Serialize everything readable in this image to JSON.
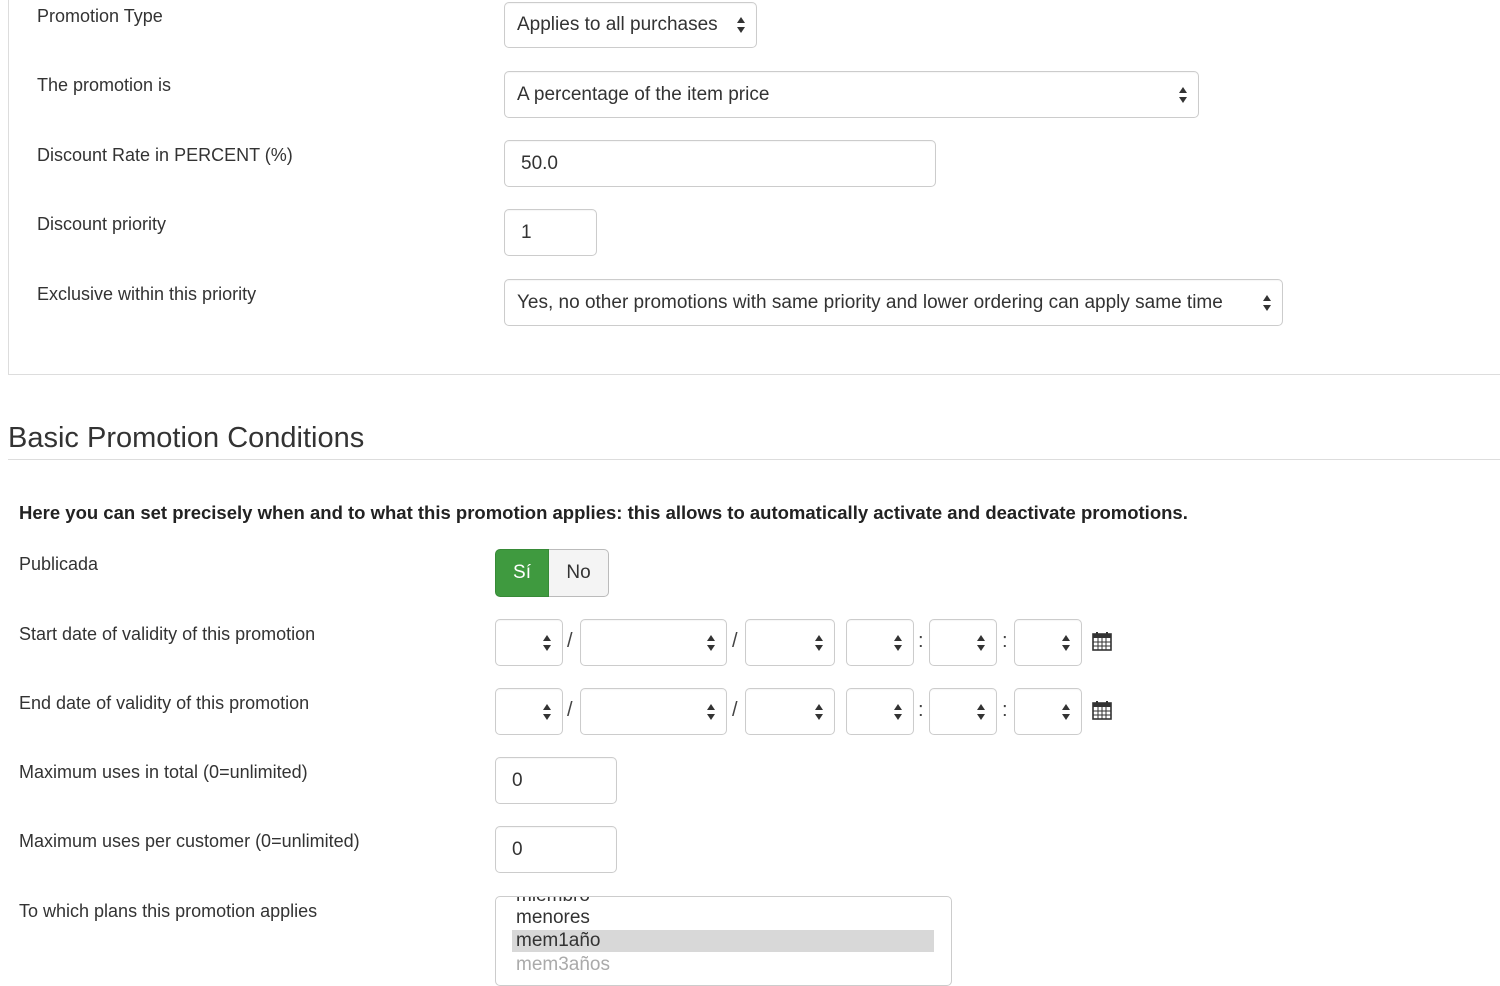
{
  "promotion": {
    "type_label": "Promotion Type",
    "type_value": "Applies to all purchases",
    "is_label": "The promotion is",
    "is_value": "A percentage of the item price",
    "rate_label": "Discount Rate in PERCENT (%)",
    "rate_value": "50.0",
    "priority_label": "Discount priority",
    "priority_value": "1",
    "exclusive_label": "Exclusive within this priority",
    "exclusive_value": "Yes, no other promotions with same priority and lower ordering can apply same time"
  },
  "conditions": {
    "heading": "Basic Promotion Conditions",
    "note": "Here you can set precisely when and to what this promotion applies: this allows to automatically activate and deactivate promotions.",
    "published_label": "Publicada",
    "published_yes": "Sí",
    "published_no": "No",
    "published_selected": "Sí",
    "start_label": "Start date of validity of this promotion",
    "end_label": "End date of validity of this promotion",
    "date_sep": "/",
    "time_sep": ":",
    "max_total_label": "Maximum uses in total (0=unlimited)",
    "max_total_value": "0",
    "max_customer_label": "Maximum uses per customer (0=unlimited)",
    "max_customer_value": "0",
    "plans_label": "To which plans this promotion applies",
    "plans_options": [
      "miembro",
      "menores",
      "mem1año",
      "mem3años"
    ],
    "plans_selected": "mem1año"
  },
  "icons": {
    "calendar": "calendar-icon",
    "select_arrows": "updown-arrows-icon"
  },
  "colors": {
    "toggle_on": "#3f9a3f",
    "selected_option": "#d8d8d8"
  }
}
